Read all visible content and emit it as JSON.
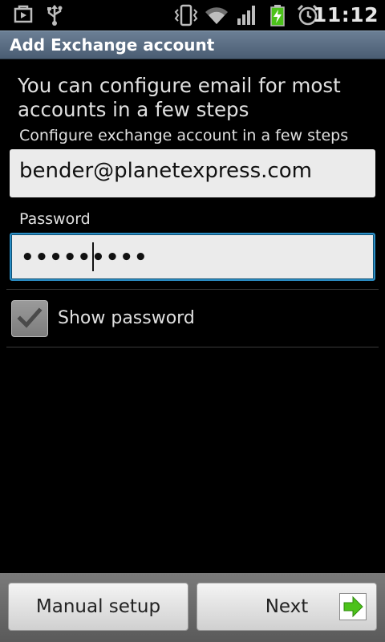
{
  "status_bar": {
    "time": "11:12",
    "icons": [
      "play-store-notification-icon",
      "usb-icon",
      "vibrate-icon",
      "wifi-icon",
      "signal-icon",
      "battery-charging-icon",
      "alarm-icon"
    ]
  },
  "titlebar": {
    "title": "Add Exchange account"
  },
  "intro": {
    "text": "You can configure email for most accounts in a few steps",
    "sublabel": "Configure exchange account in a few steps"
  },
  "form": {
    "email_value": "bender@planetexpress.com",
    "password_label": "Password",
    "password_masked": "•••••••••",
    "show_password_label": "Show password",
    "show_password_checked": true
  },
  "actions": {
    "manual_setup_label": "Manual setup",
    "next_label": "Next"
  },
  "colors": {
    "titlebar": "#55687e",
    "focus_border": "#2b8fc6",
    "next_arrow": "#4cc21a"
  }
}
